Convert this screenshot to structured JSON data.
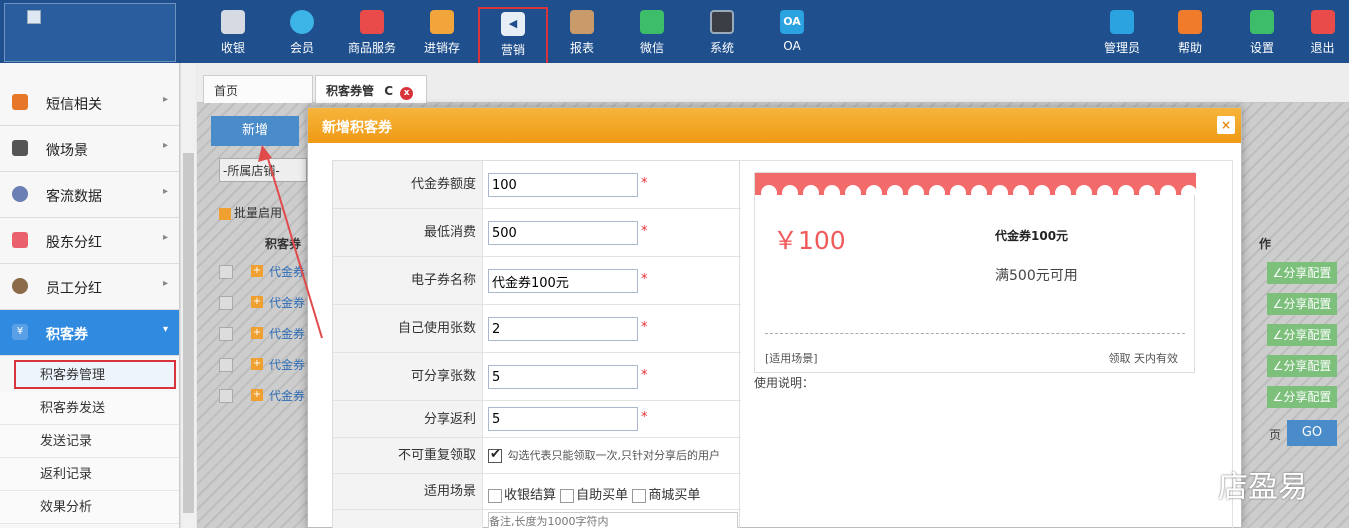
{
  "topnav": {
    "items": [
      {
        "label": "收银",
        "icon": "cashier-icon",
        "color": "#d6dbe3"
      },
      {
        "label": "会员",
        "icon": "member-icon",
        "color": "#3cb4e6"
      },
      {
        "label": "商品服务",
        "icon": "goods-icon",
        "color": "#e94b4b"
      },
      {
        "label": "进销存",
        "icon": "inventory-icon",
        "color": "#f2a53a"
      },
      {
        "label": "营销",
        "icon": "megaphone-icon",
        "color": "#e8eef5"
      },
      {
        "label": "报表",
        "icon": "report-icon",
        "color": "#c99a6a"
      },
      {
        "label": "微信",
        "icon": "wechat-icon",
        "color": "#3dbd6a"
      },
      {
        "label": "系统",
        "icon": "monitor-icon",
        "color": "#3b3f45"
      },
      {
        "label": "OA",
        "icon": "oa-icon",
        "color": "#2aa3e0",
        "glyph": "OA"
      }
    ],
    "right": [
      {
        "label": "管理员",
        "icon": "admin-icon",
        "color": "#2aa3e0"
      },
      {
        "label": "帮助",
        "icon": "help-icon",
        "color": "#f07b2a"
      },
      {
        "label": "设置",
        "icon": "settings-icon",
        "color": "#3dbd6a"
      },
      {
        "label": "退出",
        "icon": "logout-icon",
        "color": "#e94b4b"
      }
    ]
  },
  "sidebar": {
    "items": [
      {
        "label": "短信相关",
        "icon": "phone-icon",
        "color": "#e8762a"
      },
      {
        "label": "微场景",
        "icon": "mobile-icon",
        "color": "#555555"
      },
      {
        "label": "客流数据",
        "icon": "traffic-icon",
        "color": "#6b7fb5"
      },
      {
        "label": "股东分红",
        "icon": "shareholder-icon",
        "color": "#e8616b"
      },
      {
        "label": "员工分红",
        "icon": "staff-icon",
        "color": "#8b6b4a"
      },
      {
        "label": "积客券",
        "icon": "coupon-icon",
        "color": "#5aa0e6",
        "glyph": "¥"
      }
    ],
    "subitems": [
      "积客券管理",
      "积客券发送",
      "发送记录",
      "返利记录",
      "效果分析"
    ]
  },
  "tabs": {
    "home": "首页",
    "current": "积客券管",
    "close": "x",
    "refresh": "C"
  },
  "background": {
    "add_button": "新增",
    "store_select": "-所属店铺-",
    "batch_label": "批量启用",
    "column_header": "积客券",
    "row_link": "代金券",
    "op_header": "作",
    "share_label": "∠分享配置",
    "page_label": "页",
    "go_label": "GO"
  },
  "modal": {
    "title": "新增积客券",
    "close": "×",
    "fields": {
      "amount": {
        "label": "代金券额度",
        "value": "100"
      },
      "min_spend": {
        "label": "最低消费",
        "value": "500"
      },
      "name": {
        "label": "电子券名称",
        "value": "代金券100元"
      },
      "self_use": {
        "label": "自己使用张数",
        "value": "2"
      },
      "shareable": {
        "label": "可分享张数",
        "value": "5"
      },
      "rebate": {
        "label": "分享返利",
        "value": "5"
      },
      "no_repeat": {
        "label": "不可重复领取",
        "hint": "勾选代表只能领取一次,只针对分享后的用户",
        "checked": true
      },
      "scenes": {
        "label": "适用场景",
        "options": [
          "收银结算",
          "自助买单",
          "商城买单"
        ]
      },
      "note": {
        "placeholder": "备注,长度为1000字符内"
      }
    },
    "required_mark": "*"
  },
  "coupon_preview": {
    "price": "￥100",
    "name": "代金券100元",
    "desc": "满500元可用",
    "scene": "[适用场景]",
    "validity": "领取  天内有效",
    "usage_label": "使用说明："
  },
  "watermark": "店盈易"
}
